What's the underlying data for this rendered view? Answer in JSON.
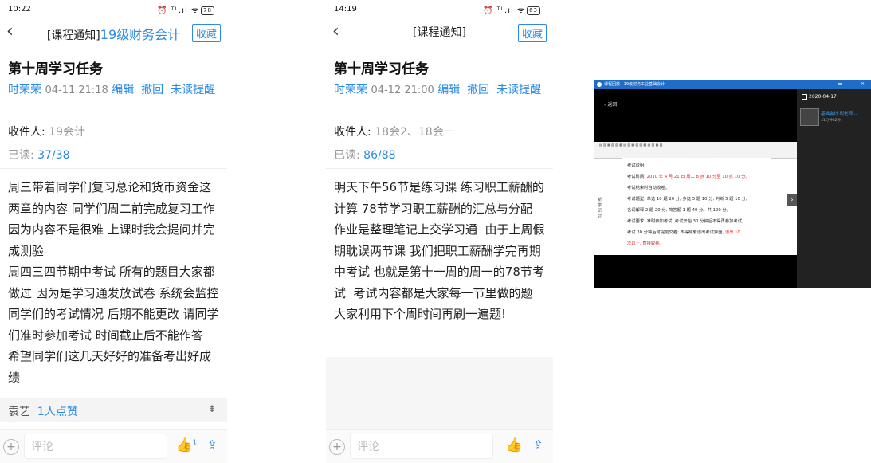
{
  "phone1": {
    "status": {
      "time": "10:22",
      "icons": "⏰ ᵀᴸ.ıl ᯤ",
      "battery": "78"
    },
    "nav": {
      "back": "‹",
      "prefix": "[课程通知]",
      "course": "19级财务会计",
      "fav": "收藏"
    },
    "title": "第十周学习任务",
    "sender": "时荣荣",
    "date": "04-11 21:18",
    "actions": [
      "编辑",
      "撤回",
      "未读提醒"
    ],
    "recipients_label": "收件人: ",
    "recipients": "19会计",
    "read_label": "已读: ",
    "read_value": "37/38",
    "body": "周三带着同学们复习总论和货币资金这两章的内容 同学们周二前完成复习工作 因为内容不是很难 上课时我会提问并完成测验\n周四三四节期中考试 所有的题目大家都做过 因为是学习通发放试卷 系统会监控同学们的考试情况 后期不能更改 请同学们准时参加考试 时间截止后不能作答  希望同学们这几天好好的准备考出好成绩",
    "likes_name": "袁艺",
    "likes_count": "1人点赞",
    "comment_placeholder": "评论",
    "thumb_count": "1"
  },
  "phone2": {
    "status": {
      "time": "14:19",
      "icons": "⏰ ᵀᴸ.ıl ᯤ",
      "battery": "63"
    },
    "nav": {
      "back": "‹",
      "prefix": "[课程通知]",
      "fav": "收藏"
    },
    "title": "第十周学习任务",
    "sender": "时荣荣",
    "date": "04-12 21:00",
    "actions": [
      "编辑",
      "撤回",
      "未读提醒"
    ],
    "recipients_label": "收件人: ",
    "recipients": "18会2、18会一",
    "read_label": "已读: ",
    "read_value": "86/88",
    "body": "明天下午56节是练习课 练习职工薪酬的计算 78节学习职工薪酬的汇总与分配 作业是整理笔记上交学习通  由于上周假期耽误两节课 我们把职工薪酬学完再期中考试 也就是第十一周的周一的78节考试  考试内容都是大家每一节里做的题 大家利用下个周时间再刷一遍题!",
    "comment_placeholder": "评论"
  },
  "video": {
    "window_title": "课程回放 · 19级财务工业基础会计",
    "back": "返回",
    "sidebar_date": "2020-04-17",
    "item_title": "基础会计·时老师...",
    "item_sub": "41分钟82秒",
    "doc_lines": [
      {
        "text": "考试说明:",
        "red": ""
      },
      {
        "text": "考试时间: ",
        "red": "2010 年 4 月 21 日 周二 8 点 10 分至 10 点 10 分。"
      },
      {
        "text": "考试结束时自动收卷。",
        "red": ""
      },
      {
        "text": "考试题型: 单选 10 题 20 分, 多选 5 题 10 分, 判断 5 题 10 分,",
        "red": ""
      },
      {
        "text": "名词解释 2 题 20 分, 简答题 1 题 40 分。共 100 分。",
        "red": ""
      },
      {
        "text": "考试要求: 准时参加考试, 考试开始 30 分钟后不得再参加考试。",
        "red": ""
      },
      {
        "text": "考试 30 分钟后可提前交卷; 不得频繁退出考试界面, ",
        "red": "退出 10"
      },
      {
        "text": "",
        "red": "次以上, 直接收卷。"
      }
    ],
    "side_text": "新\n学\n研\n讨"
  }
}
